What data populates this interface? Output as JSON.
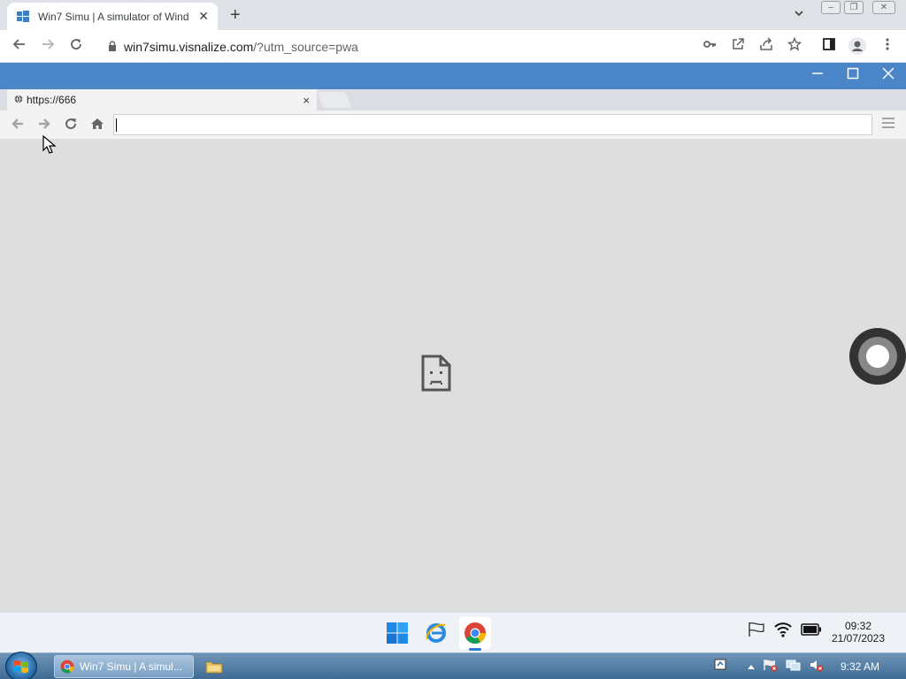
{
  "host_browser": {
    "tab_title": "Win7 Simu | A simulator of Wind",
    "url_domain": "win7simu.visnalize.com",
    "url_path": "/?utm_source=pwa",
    "new_tab_symbol": "+",
    "close_symbol": "✕"
  },
  "simulator_browser": {
    "tab_label": "https://666",
    "tab_close": "×",
    "address_value": ""
  },
  "w11_taskbar": {
    "clock_time": "09:32",
    "clock_date": "21/07/2023"
  },
  "w7_taskbar": {
    "task_chrome_label": "Win7 Simu | A simul...",
    "clock": "9:32 AM"
  },
  "colors": {
    "app_titlebar": "#4a86c8",
    "content_bg": "#dedede"
  }
}
